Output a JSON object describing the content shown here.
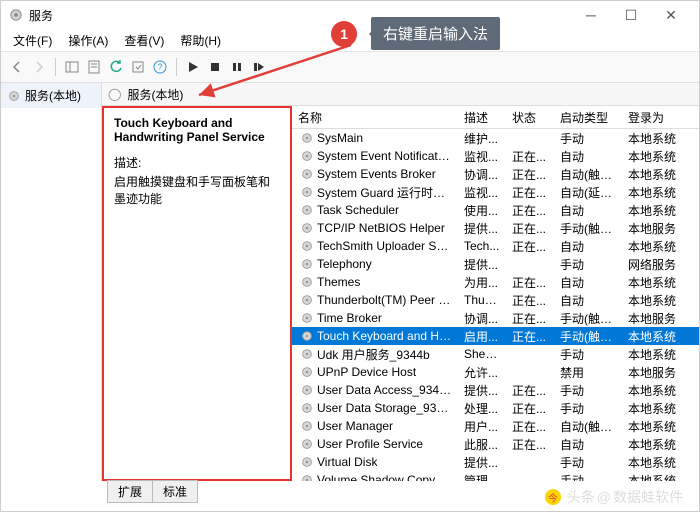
{
  "window": {
    "title": "服务"
  },
  "menu": {
    "file": "文件(F)",
    "action": "操作(A)",
    "view": "查看(V)",
    "help": "帮助(H)"
  },
  "sidebar": {
    "item": "服务(本地)"
  },
  "location": {
    "text": "服务(本地)"
  },
  "detail": {
    "title1": "Touch Keyboard and",
    "title2": "Handwriting Panel Service",
    "desc_label": "描述:",
    "desc_text": "启用触摸键盘和手写面板笔和墨迹功能"
  },
  "columns": {
    "name": "名称",
    "desc": "描述",
    "status": "状态",
    "startup": "启动类型",
    "logon": "登录为"
  },
  "services": [
    {
      "n": "SysMain",
      "d": "维护...",
      "s": "",
      "t": "手动",
      "l": "本地系统"
    },
    {
      "n": "System Event Notification ...",
      "d": "监视...",
      "s": "正在...",
      "t": "自动",
      "l": "本地系统"
    },
    {
      "n": "System Events Broker",
      "d": "协调...",
      "s": "正在...",
      "t": "自动(触发...",
      "l": "本地系统"
    },
    {
      "n": "System Guard 运行时监视...",
      "d": "监视...",
      "s": "正在...",
      "t": "自动(延迟...",
      "l": "本地系统"
    },
    {
      "n": "Task Scheduler",
      "d": "使用...",
      "s": "正在...",
      "t": "自动",
      "l": "本地系统"
    },
    {
      "n": "TCP/IP NetBIOS Helper",
      "d": "提供...",
      "s": "正在...",
      "t": "手动(触发...",
      "l": "本地服务"
    },
    {
      "n": "TechSmith Uploader Service",
      "d": "Tech...",
      "s": "正在...",
      "t": "自动",
      "l": "本地系统"
    },
    {
      "n": "Telephony",
      "d": "提供...",
      "s": "",
      "t": "手动",
      "l": "网络服务"
    },
    {
      "n": "Themes",
      "d": "为用...",
      "s": "正在...",
      "t": "自动",
      "l": "本地系统"
    },
    {
      "n": "Thunderbolt(TM) Peer to P...",
      "d": "Thun...",
      "s": "正在...",
      "t": "自动",
      "l": "本地系统"
    },
    {
      "n": "Time Broker",
      "d": "协调...",
      "s": "正在...",
      "t": "手动(触发...",
      "l": "本地服务"
    },
    {
      "n": "Touch Keyboard and Hand...",
      "d": "启用...",
      "s": "正在...",
      "t": "手动(触发...",
      "l": "本地系统"
    },
    {
      "n": "Udk 用户服务_9344b",
      "d": "Shell...",
      "s": "",
      "t": "手动",
      "l": "本地系统"
    },
    {
      "n": "UPnP Device Host",
      "d": "允许...",
      "s": "",
      "t": "禁用",
      "l": "本地服务"
    },
    {
      "n": "User Data Access_9344b",
      "d": "提供...",
      "s": "正在...",
      "t": "手动",
      "l": "本地系统"
    },
    {
      "n": "User Data Storage_9344b",
      "d": "处理...",
      "s": "正在...",
      "t": "手动",
      "l": "本地系统"
    },
    {
      "n": "User Manager",
      "d": "用户...",
      "s": "正在...",
      "t": "自动(触发...",
      "l": "本地系统"
    },
    {
      "n": "User Profile Service",
      "d": "此服...",
      "s": "正在...",
      "t": "自动",
      "l": "本地系统"
    },
    {
      "n": "Virtual Disk",
      "d": "提供...",
      "s": "",
      "t": "手动",
      "l": "本地系统"
    },
    {
      "n": "Volume Shadow Copy",
      "d": "管理...",
      "s": "",
      "t": "手动",
      "l": "本地系统"
    }
  ],
  "selected_index": 11,
  "tabs": {
    "ext": "扩展",
    "std": "标准"
  },
  "callout": {
    "num": "1",
    "text": "右键重启输入法"
  },
  "watermark": {
    "prefix": "头条",
    "name": "数据蛙软件"
  }
}
